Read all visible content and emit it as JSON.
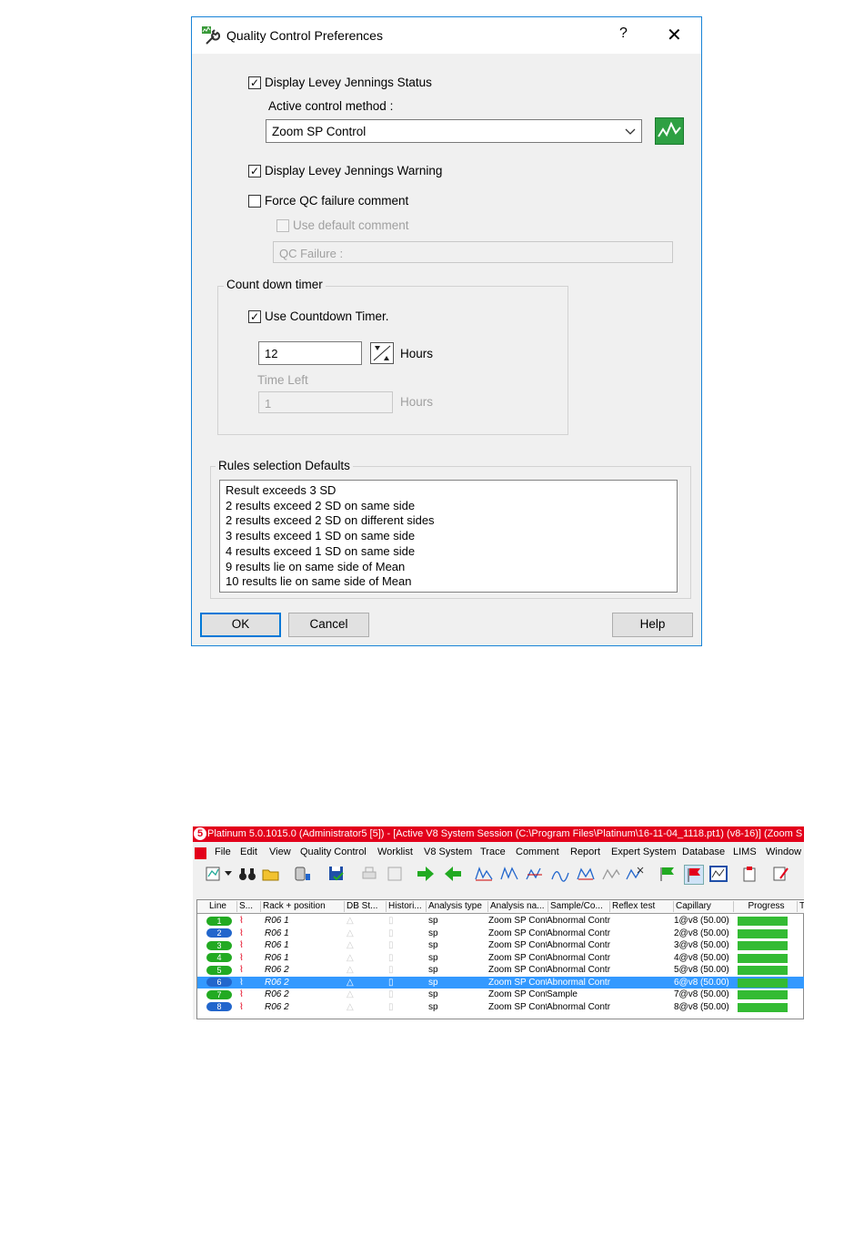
{
  "dialog": {
    "title": "Quality Control Preferences",
    "help_glyph": "?",
    "close_glyph": "✕",
    "display_lj_status": {
      "label": "Display Levey Jennings Status",
      "checked": true
    },
    "active_control_method_label": "Active control method :",
    "active_control_method_value": "Zoom SP Control",
    "display_lj_warning": {
      "label": "Display Levey Jennings Warning",
      "checked": true
    },
    "force_qc_failure_comment": {
      "label": "Force QC failure comment",
      "checked": false
    },
    "use_default_comment": {
      "label": "Use default comment",
      "checked": false
    },
    "qc_failure_field": "QC Failure :",
    "countdown_group_title": "Count down timer",
    "use_countdown_timer": {
      "label": "Use Countdown Timer.",
      "checked": true
    },
    "hours_value": "12",
    "hours_label": "Hours",
    "time_left_label": "Time Left",
    "time_left_value": "1",
    "time_left_hours_label": "Hours",
    "rules_group_title": "Rules selection Defaults",
    "rules": [
      "Result exceeds 3 SD",
      "2 results exceed 2 SD on same side",
      "2 results exceed 2 SD on different sides",
      "3 results exceed 1 SD on same side",
      "4 results exceed 1 SD on same side",
      "9 results lie on same side of Mean",
      "10 results lie on same side of Mean"
    ],
    "ok_label": "OK",
    "cancel_label": "Cancel",
    "help_label": "Help"
  },
  "app": {
    "logo": "5",
    "title": "Platinum 5.0.1015.0  (Administrator5 [5]) - [Active V8 System Session (C:\\Program Files\\Platinum\\16-11-04_1118.pt1) (v8-16)]        (Zoom S",
    "menu": [
      "File",
      "Edit",
      "View",
      "Quality Control",
      "Worklist",
      "V8 System",
      "Trace",
      "Comment",
      "Report",
      "Expert System",
      "Database",
      "LIMS",
      "Window"
    ],
    "columns": [
      "Line",
      "S...",
      "Rack + position",
      "DB St...",
      "Histori...",
      "Analysis type",
      "Analysis na...",
      "Sample/Co...",
      "Reflex test",
      "Capillary",
      "Progress",
      "T"
    ],
    "rows": [
      {
        "line": "1",
        "rack": "R06 1",
        "type": "sp",
        "name": "Zoom SP Contr",
        "sample": "Abnormal Contr",
        "capillary": "1@v8 (50.00)",
        "pill_color": "#22aa22",
        "selected": false
      },
      {
        "line": "2",
        "rack": "R06 1",
        "type": "sp",
        "name": "Zoom SP Contr",
        "sample": "Abnormal Contr",
        "capillary": "2@v8 (50.00)",
        "pill_color": "#2266cc",
        "selected": false
      },
      {
        "line": "3",
        "rack": "R06 1",
        "type": "sp",
        "name": "Zoom SP Contr",
        "sample": "Abnormal Contr",
        "capillary": "3@v8 (50.00)",
        "pill_color": "#22aa22",
        "selected": false
      },
      {
        "line": "4",
        "rack": "R06 1",
        "type": "sp",
        "name": "Zoom SP Contr",
        "sample": "Abnormal Contr",
        "capillary": "4@v8 (50.00)",
        "pill_color": "#22aa22",
        "selected": false
      },
      {
        "line": "5",
        "rack": "R06 2",
        "type": "sp",
        "name": "Zoom SP Contr",
        "sample": "Abnormal Contr",
        "capillary": "5@v8 (50.00)",
        "pill_color": "#22aa22",
        "selected": false
      },
      {
        "line": "6",
        "rack": "R06 2",
        "type": "sp",
        "name": "Zoom SP Contr",
        "sample": "Abnormal Contr",
        "capillary": "6@v8 (50.00)",
        "pill_color": "#2266cc",
        "selected": true
      },
      {
        "line": "7",
        "rack": "R06 2",
        "type": "sp",
        "name": "Zoom SP Contr",
        "sample": "Sample",
        "capillary": "7@v8 (50.00)",
        "pill_color": "#22aa22",
        "selected": false
      },
      {
        "line": "8",
        "rack": "R06 2",
        "type": "sp",
        "name": "Zoom SP Contr",
        "sample": "Abnormal Contr",
        "capillary": "8@v8 (50.00)",
        "pill_color": "#2266cc",
        "selected": false
      }
    ],
    "accent": "#e3001b",
    "selection_color": "#3399ff",
    "progress_color": "#33bb33"
  }
}
